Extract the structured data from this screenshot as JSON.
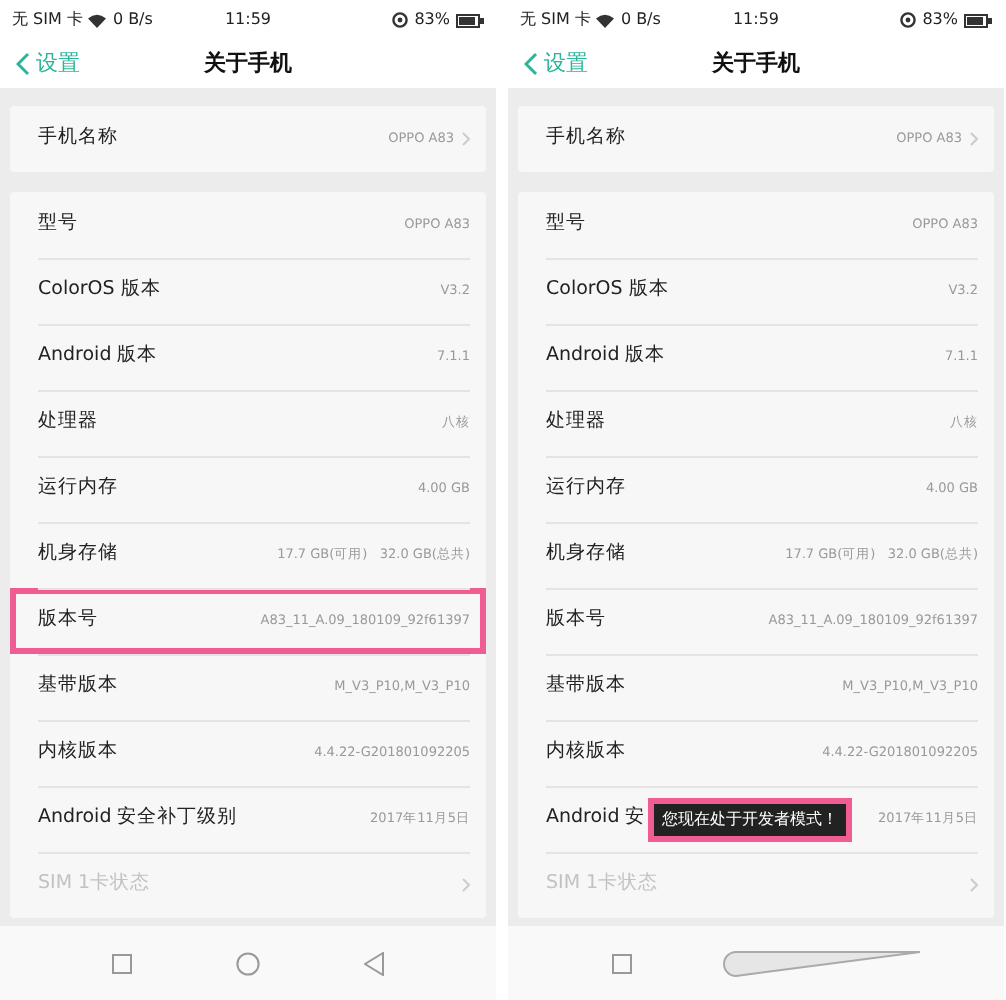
{
  "phones": [
    {
      "status_bar": {
        "carrier": "无 SIM 卡",
        "speed": "0 B/s",
        "time": "11:59",
        "battery": "83%"
      },
      "header": {
        "back": "设置",
        "title": "关于手机"
      },
      "groups": [
        {
          "rows": [
            {
              "label": "手机名称",
              "value": "OPPO A83",
              "chevron": true,
              "highlighted": false,
              "disabled": false
            }
          ]
        },
        {
          "rows": [
            {
              "label": "型号",
              "value": "OPPO A83",
              "chevron": false,
              "highlighted": false,
              "disabled": false
            },
            {
              "label": "ColorOS 版本",
              "value": "V3.2",
              "chevron": false,
              "highlighted": false,
              "disabled": false
            },
            {
              "label": "Android 版本",
              "value": "7.1.1",
              "chevron": false,
              "highlighted": false,
              "disabled": false
            },
            {
              "label": "处理器",
              "value": "八核",
              "chevron": false,
              "highlighted": false,
              "disabled": false
            },
            {
              "label": "运行内存",
              "value": "4.00 GB",
              "chevron": false,
              "highlighted": false,
              "disabled": false
            },
            {
              "label": "机身存储",
              "value": "17.7 GB(可用)   32.0 GB(总共)",
              "chevron": false,
              "highlighted": false,
              "disabled": false
            },
            {
              "label": "版本号",
              "value": "A83_11_A.09_180109_92f61397",
              "chevron": false,
              "highlighted": true,
              "disabled": false
            },
            {
              "label": "基带版本",
              "value": "M_V3_P10,M_V3_P10",
              "chevron": false,
              "highlighted": false,
              "disabled": false
            },
            {
              "label": "内核版本",
              "value": "4.4.22-G201801092205",
              "chevron": false,
              "highlighted": false,
              "disabled": false
            },
            {
              "label": "Android 安全补丁级别",
              "value": "2017年11月5日",
              "chevron": false,
              "highlighted": false,
              "disabled": false
            },
            {
              "label": "SIM 1卡状态",
              "chevron": true,
              "highlighted": false,
              "disabled": true
            }
          ]
        }
      ],
      "nav_bar": {
        "kind": "buttons"
      }
    },
    {
      "status_bar": {
        "carrier": "无 SIM 卡",
        "speed": "0 B/s",
        "time": "11:59",
        "battery": "83%"
      },
      "header": {
        "back": "设置",
        "title": "关于手机"
      },
      "groups": [
        {
          "rows": [
            {
              "label": "手机名称",
              "value": "OPPO A83",
              "chevron": true,
              "highlighted": false,
              "disabled": false
            }
          ]
        },
        {
          "rows": [
            {
              "label": "型号",
              "value": "OPPO A83",
              "chevron": false,
              "highlighted": false,
              "disabled": false
            },
            {
              "label": "ColorOS 版本",
              "value": "V3.2",
              "chevron": false,
              "highlighted": false,
              "disabled": false
            },
            {
              "label": "Android 版本",
              "value": "7.1.1",
              "chevron": false,
              "highlighted": false,
              "disabled": false
            },
            {
              "label": "处理器",
              "value": "八核",
              "chevron": false,
              "highlighted": false,
              "disabled": false
            },
            {
              "label": "运行内存",
              "value": "4.00 GB",
              "chevron": false,
              "highlighted": false,
              "disabled": false
            },
            {
              "label": "机身存储",
              "value": "17.7 GB(可用)   32.0 GB(总共)",
              "chevron": false,
              "highlighted": false,
              "disabled": false
            },
            {
              "label": "版本号",
              "value": "A83_11_A.09_180109_92f61397",
              "chevron": false,
              "highlighted": false,
              "disabled": false
            },
            {
              "label": "基带版本",
              "value": "M_V3_P10,M_V3_P10",
              "chevron": false,
              "highlighted": false,
              "disabled": false
            },
            {
              "label": "内核版本",
              "value": "4.4.22-G201801092205",
              "chevron": false,
              "highlighted": false,
              "disabled": false
            },
            {
              "label": "Android 安",
              "value": "2017年11月5日",
              "toast": "您现在处于开发者模式！",
              "chevron": false,
              "highlighted": false,
              "disabled": false
            },
            {
              "label": "SIM 1卡状态",
              "chevron": true,
              "highlighted": false,
              "disabled": true
            }
          ]
        }
      ],
      "nav_bar": {
        "kind": "gesture"
      }
    }
  ]
}
